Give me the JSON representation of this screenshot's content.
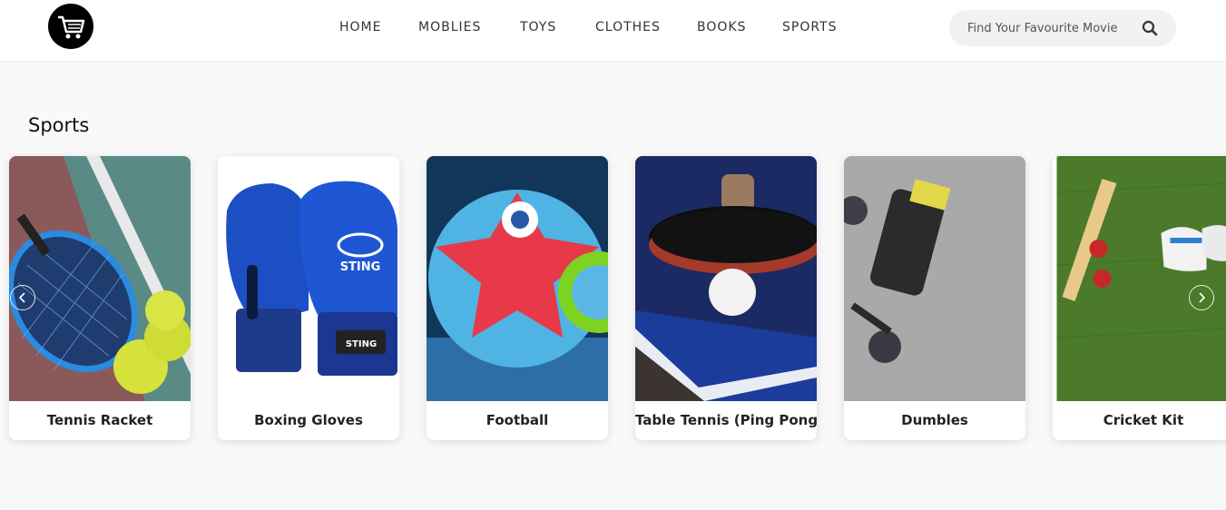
{
  "header": {
    "logo_icon": "shopping-cart-icon",
    "nav": [
      {
        "label": "HOME"
      },
      {
        "label": "MOBLIES"
      },
      {
        "label": "TOYS"
      },
      {
        "label": "CLOTHES"
      },
      {
        "label": "BOOKS"
      },
      {
        "label": "SPORTS"
      }
    ],
    "search": {
      "placeholder": "Find Your Favourite Movie",
      "icon": "search-icon"
    }
  },
  "section": {
    "title": "Sports",
    "prev_icon": "chevron-left-icon",
    "next_icon": "chevron-right-icon",
    "cards": [
      {
        "title": "Tennis Racket"
      },
      {
        "title": "Boxing Gloves"
      },
      {
        "title": "Football"
      },
      {
        "title": "Table Tennis (Ping Pong)"
      },
      {
        "title": "Dumbles"
      },
      {
        "title": "Cricket Kit"
      }
    ]
  },
  "colors": {
    "header_bg": "#ffffff",
    "page_bg": "#f8f8f8",
    "text": "#222222"
  }
}
